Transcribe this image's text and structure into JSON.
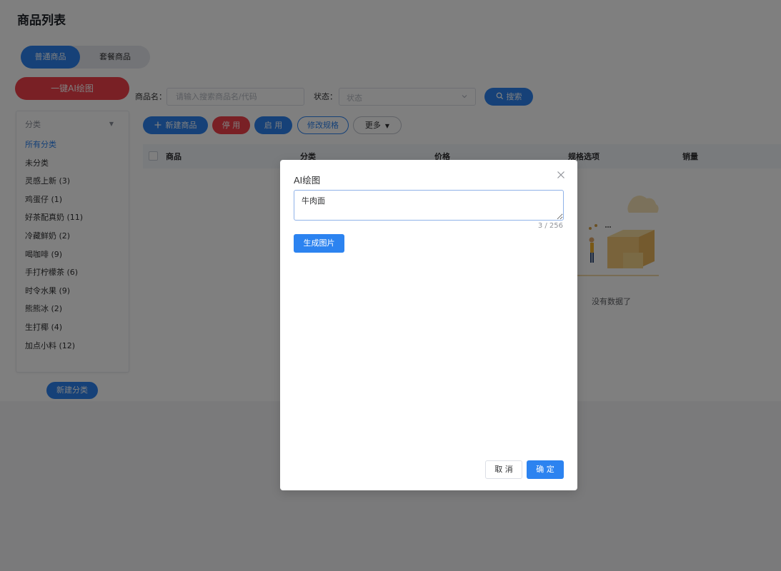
{
  "header": {
    "title": "商品列表"
  },
  "product_type_tabs": [
    {
      "label": "普通商品",
      "active": true
    },
    {
      "label": "套餐商品",
      "active": false
    }
  ],
  "ai_draw_button": {
    "label": "一键AI绘图"
  },
  "category_panel": {
    "select_label": "分类",
    "items": [
      {
        "label": "所有分类",
        "active": true
      },
      {
        "label": "未分类"
      },
      {
        "label": "灵感上新 (3)"
      },
      {
        "label": "鸡蛋仔 (1)"
      },
      {
        "label": "好茶配真奶 (11)"
      },
      {
        "label": "冷藏鲜奶 (2)"
      },
      {
        "label": "喝咖啡 (9)"
      },
      {
        "label": "手打柠檬茶 (6)"
      },
      {
        "label": "时令水果 (9)"
      },
      {
        "label": "熊熊冰 (2)"
      },
      {
        "label": "生打椰 (4)"
      },
      {
        "label": "加点小料 (12)"
      }
    ],
    "new_category_label": "新建分类"
  },
  "filters": {
    "name_label": "商品名：",
    "name_placeholder": "请输入搜索商品名/代码",
    "name_value": "",
    "status_label": "状态：",
    "status_placeholder": "状态",
    "search_label": "搜索"
  },
  "toolbar": {
    "new_product": "新建商品",
    "disable": "停 用",
    "enable": "启 用",
    "edit_spec": "修改规格",
    "more": "更多"
  },
  "table": {
    "columns": [
      "商品",
      "分类",
      "价格",
      "规格选项",
      "销量"
    ],
    "rows": [],
    "empty_text": "没有数据了"
  },
  "modal": {
    "title": "AI绘图",
    "prompt_value": "牛肉面",
    "char_count": "3 / 256",
    "generate_label": "生成图片",
    "cancel_label": "取 消",
    "ok_label": "确 定"
  },
  "colors": {
    "primary": "#2c83f0",
    "danger": "#f2414b",
    "overlay": "rgba(0,0,0,0.5)"
  },
  "icons": {
    "search": "search-icon",
    "plus": "plus-icon",
    "close": "close-icon",
    "caret": "caret-down-icon"
  }
}
